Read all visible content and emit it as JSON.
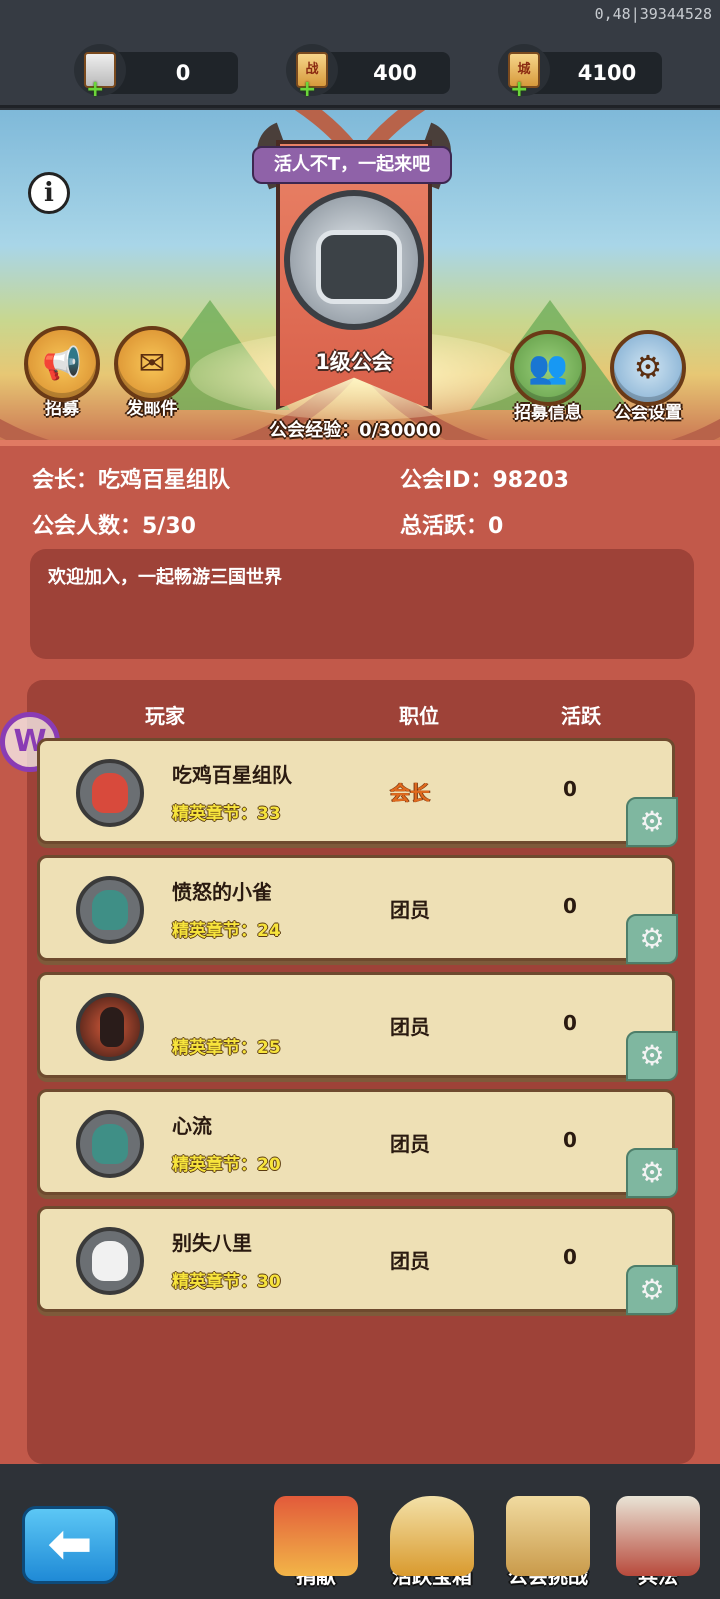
{
  "debug_text": "0,48|39344528",
  "resources": [
    {
      "icon": "hand-scroll-icon",
      "value": "0"
    },
    {
      "icon": "battle-scroll-icon",
      "glyph": "战",
      "value": "400"
    },
    {
      "icon": "city-scroll-icon",
      "glyph": "城",
      "value": "4100"
    }
  ],
  "guild": {
    "motto": "活人不T，一起来吧",
    "level": "1级公会",
    "exp": "公会经验：0/30000",
    "leader": "会长：吃鸡百星组队",
    "id": "公会ID：98203",
    "members": "公会人数：5/30",
    "activity": "总活跃：0",
    "notice": "欢迎加入，一起畅游三国世界"
  },
  "buttons": {
    "recruit": "招募",
    "mail": "发邮件",
    "recruit_info": "招募信息",
    "settings": "公会设置"
  },
  "columns": {
    "player": "玩家",
    "position": "职位",
    "activity": "活跃"
  },
  "member_list": [
    {
      "name": "吃鸡百星组队",
      "chapter": "精英章节：33",
      "role": "会长",
      "activity": "0"
    },
    {
      "name": "愤怒的小雀",
      "chapter": "精英章节：24",
      "role": "团员",
      "activity": "0"
    },
    {
      "name": "",
      "chapter": "精英章节：25",
      "role": "团员",
      "activity": "0"
    },
    {
      "name": "心流",
      "chapter": "精英章节：20",
      "role": "团员",
      "activity": "0"
    },
    {
      "name": "别失八里",
      "chapter": "精英章节：30",
      "role": "团员",
      "activity": "0"
    }
  ],
  "bottom_nav": {
    "donate": "捐献",
    "chest": "活跃宝箱",
    "challenge": "公会挑战",
    "tactics": "兵法"
  },
  "colors": {
    "panel": "#c2594a",
    "row": "#eee0b5",
    "leader_role": "#e06a1e",
    "chapter": "#f7e43c"
  }
}
